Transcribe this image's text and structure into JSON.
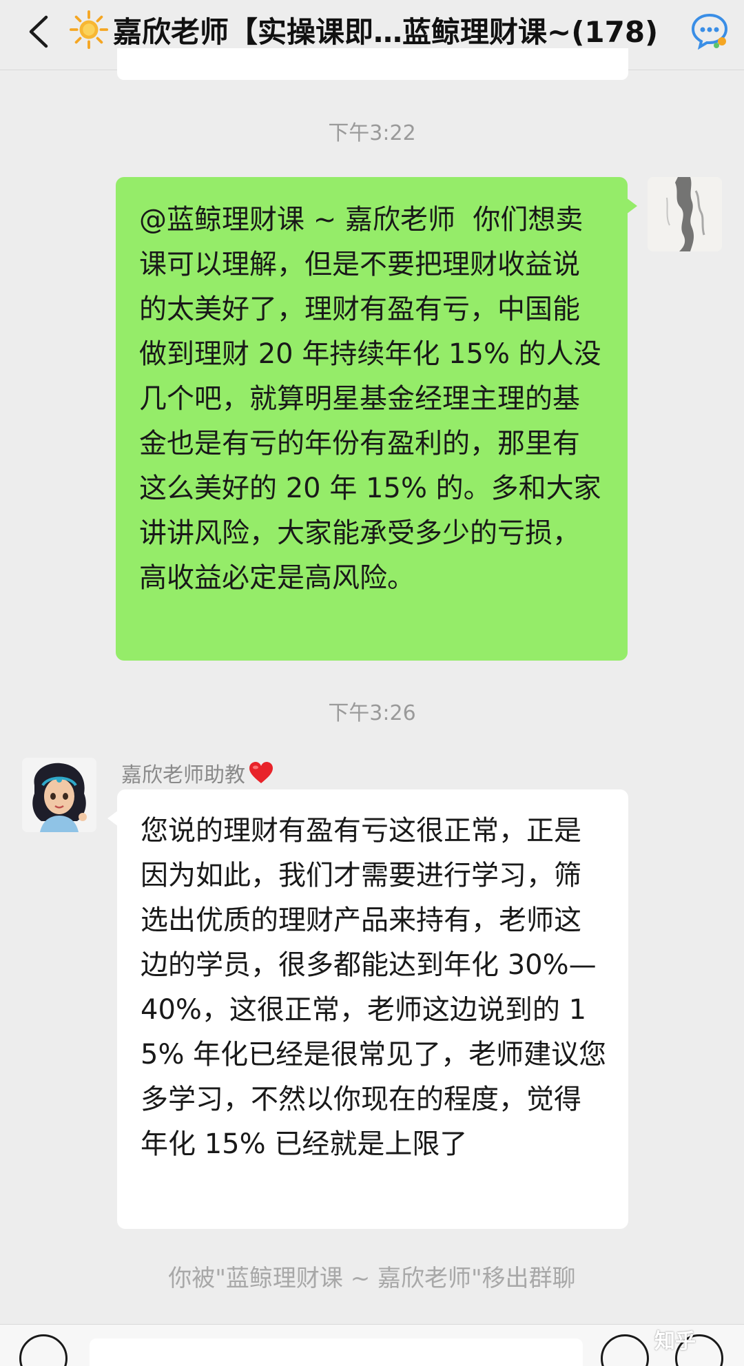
{
  "header": {
    "title": "嘉欣老师【实操课即…蓝鲸理财课~(178)",
    "back_icon": "chevron-left-icon",
    "group_icon": "group-chat-icon",
    "title_emoji_icon": "sun-icon"
  },
  "messages": {
    "timestamp_1": "下午3:22",
    "own_message": "@蓝鲸理财课 ~ 嘉欣老师  你们想卖课可以理解，但是不要把理财收益说的太美好了，理财有盈有亏，中国能做到理财 20 年持续年化 15% 的人没几个吧，就算明星基金经理主理的基金也是有亏的年份有盈利的，那里有这么美好的 20 年 15% 的。多和大家讲讲风险，大家能承受多少的亏损，高收益必定是高风险。",
    "timestamp_2": "下午3:26",
    "reply_sender": "嘉欣老师助教",
    "reply_sender_icon": "heart-icon",
    "reply_message": "您说的理财有盈有亏这很正常，正是因为如此，我们才需要进行学习，筛选出优质的理财产品来持有，老师这边的学员，很多都能达到年化 30%—40%，这很正常，老师这边说到的 15% 年化已经是很常见了，老师建议您多学习，不然以你现在的程度，觉得年化 15% 已经就是上限了",
    "system_notice": "你被\"蓝鲸理财课 ~ 嘉欣老师\"移出群聊"
  },
  "footer": {
    "watermark": "知乎"
  },
  "colors": {
    "background": "#ededed",
    "own_bubble": "#95ec69",
    "other_bubble": "#ffffff",
    "timestamp": "#9a9a9a"
  }
}
